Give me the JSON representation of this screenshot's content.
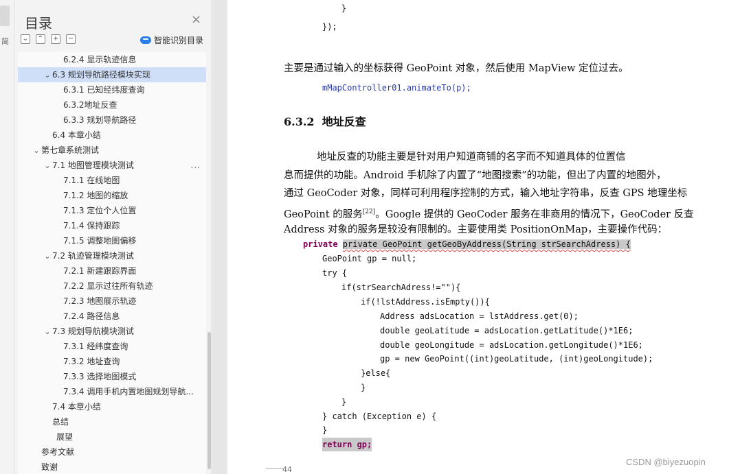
{
  "toc": {
    "title": "目录",
    "smart_label": "智能识别目录",
    "items": [
      {
        "label": "6.2.4  显示轨迹信息",
        "indent": 3,
        "chev": ""
      },
      {
        "label": "6.3  规划导航路径模块实现",
        "indent": 2,
        "chev": "⌄",
        "selected": true
      },
      {
        "label": "6.3.1  已知经纬度查询",
        "indent": 3,
        "chev": ""
      },
      {
        "label": "6.3.2地址反查",
        "indent": 3,
        "chev": ""
      },
      {
        "label": "6.3.3 规划导航路径",
        "indent": 3,
        "chev": ""
      },
      {
        "label": "6.4 本章小结",
        "indent": 2,
        "chev": ""
      },
      {
        "label": "第七章系统测试",
        "indent": 1,
        "chev": "⌄"
      },
      {
        "label": "7.1 地图管理模块测试",
        "indent": 2,
        "chev": "⌄",
        "more": "..."
      },
      {
        "label": "7.1.1  在线地图",
        "indent": 3,
        "chev": ""
      },
      {
        "label": "7.1.2  地图的缩放",
        "indent": 3,
        "chev": ""
      },
      {
        "label": "7.1.3  定位个人位置",
        "indent": 3,
        "chev": ""
      },
      {
        "label": "7.1.4  保持跟踪",
        "indent": 3,
        "chev": ""
      },
      {
        "label": "7.1.5  调整地图偏移",
        "indent": 3,
        "chev": ""
      },
      {
        "label": "7.2 轨迹管理模块测试",
        "indent": 2,
        "chev": "⌄"
      },
      {
        "label": "7.2.1  新建跟踪界面",
        "indent": 3,
        "chev": ""
      },
      {
        "label": "7.2.2  显示过往所有轨迹",
        "indent": 3,
        "chev": ""
      },
      {
        "label": "7.2.3  地图展示轨迹",
        "indent": 3,
        "chev": ""
      },
      {
        "label": "7.2.4  路径信息",
        "indent": 3,
        "chev": ""
      },
      {
        "label": "7.3  规划导航模块测试",
        "indent": 2,
        "chev": "⌄"
      },
      {
        "label": "7.3.1  经纬度查询",
        "indent": 3,
        "chev": ""
      },
      {
        "label": "7.3.2  地址查询",
        "indent": 3,
        "chev": ""
      },
      {
        "label": "7.3.3  选择地图模式",
        "indent": 3,
        "chev": ""
      },
      {
        "label": "7.3.4 调用手机内置地图规划导航...",
        "indent": 3,
        "chev": ""
      },
      {
        "label": "7.4  本章小结",
        "indent": 2,
        "chev": ""
      },
      {
        "label": "总结",
        "indent": 2,
        "chev": ""
      },
      {
        "label": "展望",
        "indent": 2.3,
        "chev": ""
      },
      {
        "label": "参考文献",
        "indent": 1,
        "chev": ""
      },
      {
        "label": "致谢",
        "indent": 1,
        "chev": ""
      }
    ]
  },
  "doc": {
    "code_top": [
      "}",
      "});"
    ],
    "para1": "主要是通过输入的坐标获得 GeoPoint 对象，然后使用 MapView 定位过去。",
    "code_animate": "mMapController01.animateTo(p);",
    "heading_num": "6.3.2",
    "heading_text": "地址反查",
    "para2_lines": [
      "地址反查的功能主要是针对用户知道商铺的名字而不知道具体的位置信",
      "息而提供的功能。Android 手机除了内置了“地图搜索”的功能，但出了内置的地图外，",
      "通过 GeoCoder 对象，同样可利用程序控制的方式，输入地址字符串，反查 GPS 地理坐标",
      "GeoPoint 的服务",
      "。Google 提供的 GeoCoder 服务在非商用的情况下，GeoCoder 反查",
      "Address 对象的服务是较没有限制的。主要使用类 PositionOnMap，主要操作代码："
    ],
    "ref": "[22]",
    "code": [
      "private GeoPoint getGeoByAddress(String strSearchAdress) {",
      "GeoPoint gp = null;",
      "try {",
      "if(strSearchAdress!=\"\"){",
      "if(!lstAddress.isEmpty()){",
      "Address adsLocation = lstAddress.get(0);",
      "double geoLatitude = adsLocation.getLatitude()*1E6;",
      "double geoLongitude = adsLocation.getLongitude()*1E6;",
      "gp = new GeoPoint((int)geoLatitude, (int)geoLongitude);",
      "}else{",
      "}",
      "}",
      "} catch (Exception e) {",
      "}",
      "return gp;"
    ],
    "page_number": "44",
    "watermark": "CSDN @biyezuopin"
  },
  "rail": {
    "mark": "简"
  }
}
